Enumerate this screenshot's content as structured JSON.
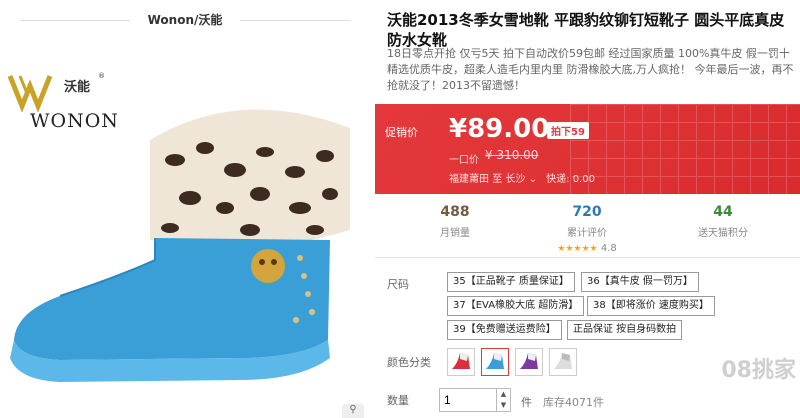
{
  "brand_header": "Wonon/沃能",
  "logo": {
    "cn": "沃能",
    "en": "WONON",
    "reg": "®"
  },
  "product": {
    "title": "沃能2013冬季女雪地靴 平跟豹纹铆钉短靴子 圆头平底真皮防水女靴",
    "description": "18日零点开抢 仅亏5天 拍下自动改价59包邮 经过国家质量 100%真牛皮 假一罚十 精选优质牛皮，超柔人造毛内里内里 防滑橡胶大底,万人疯抢！ 今年最后一波，再不抢就没了！2013不留遗憾！"
  },
  "promo": {
    "label": "促销价",
    "price": "¥89.00",
    "tag": "拍下59",
    "original_label": "一口价",
    "original_price": "¥ 310.00",
    "ship_from": "福建莆田",
    "ship_to_label": "至",
    "ship_to": "长沙",
    "express": "快递: 0.00"
  },
  "stats": {
    "monthly_sales": {
      "value": "488",
      "label": "月销量"
    },
    "reviews": {
      "value": "720",
      "label": "累计评价",
      "rating": "4.8",
      "stars": "★★★★★"
    },
    "points": {
      "value": "44",
      "label": "送天猫积分"
    }
  },
  "size": {
    "label": "尺码",
    "options": [
      "35【正品靴子 质量保证】",
      "36【真牛皮 假一罚万】",
      "37【EVA橡胶大底 超防滑】",
      "38【即将涨价 速度购买】",
      "39【免费赠送运费险】",
      "正品保证 按自身码数拍"
    ]
  },
  "color": {
    "label": "颜色分类"
  },
  "quantity": {
    "label": "数量",
    "value": "1",
    "unit": "件",
    "stock": "库存4071件"
  },
  "watermark": "08挑家",
  "zoom_icon": "zoom-icon"
}
